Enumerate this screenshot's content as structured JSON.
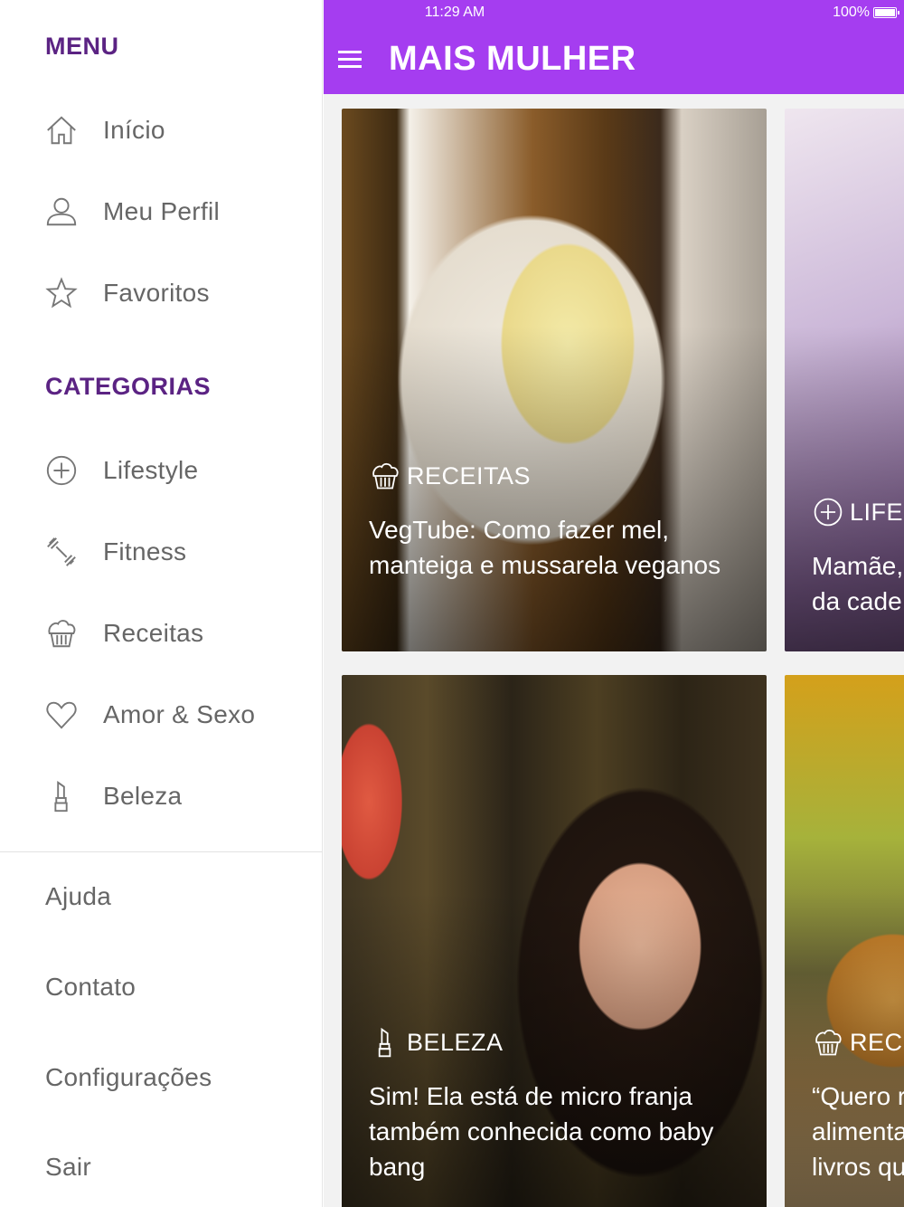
{
  "drawer": {
    "menu_title": "MENU",
    "menu_items": [
      {
        "label": "Início",
        "icon": "home-icon"
      },
      {
        "label": "Meu Perfil",
        "icon": "user-icon"
      },
      {
        "label": "Favoritos",
        "icon": "star-icon"
      }
    ],
    "categories_title": "CATEGORIAS",
    "category_items": [
      {
        "label": "Lifestyle",
        "icon": "plus-circle-icon"
      },
      {
        "label": "Fitness",
        "icon": "dumbbell-icon"
      },
      {
        "label": "Receitas",
        "icon": "cupcake-icon"
      },
      {
        "label": "Amor & Sexo",
        "icon": "heart-icon"
      },
      {
        "label": "Beleza",
        "icon": "lipstick-icon"
      }
    ],
    "bottom_items": [
      "Ajuda",
      "Contato",
      "Configurações",
      "Sair"
    ]
  },
  "status_bar": {
    "time": "11:29 AM",
    "battery": "100%"
  },
  "app_bar": {
    "title": "MAIS MULHER"
  },
  "cards": [
    {
      "category": "RECEITAS",
      "category_icon": "cupcake-icon",
      "headline": "VegTube: Como fazer mel, manteiga e mussarela veganos"
    },
    {
      "category": "LIFES",
      "category_icon": "plus-circle-icon",
      "headline": "Mamãe, da cade"
    },
    {
      "category": "BELEZA",
      "category_icon": "lipstick-icon",
      "headline": "Sim! Ela está de micro franja também conhecida como baby bang"
    },
    {
      "category": "RECE",
      "category_icon": "cupcake-icon",
      "headline": "“Quero r alimenta livros qu"
    }
  ],
  "colors": {
    "accent": "#a53df0",
    "section_title": "#5b2383",
    "drawer_text": "#666666"
  }
}
